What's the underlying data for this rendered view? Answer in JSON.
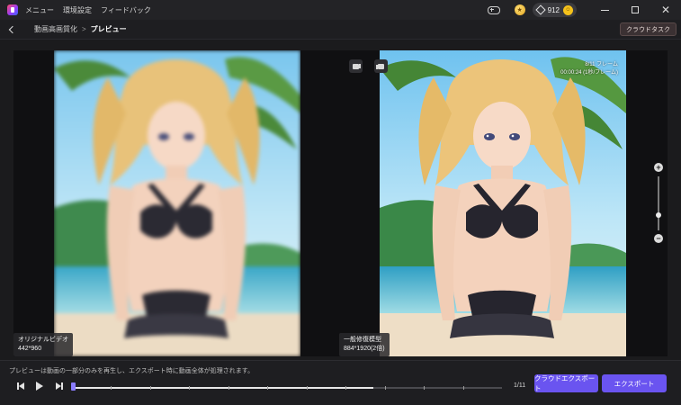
{
  "menu": {
    "items": [
      "メニュー",
      "環境設定",
      "フィードバック"
    ]
  },
  "status": {
    "credits": "912"
  },
  "breadcrumb": {
    "parent": "動画高画質化",
    "separator": ">",
    "current": "プレビュー"
  },
  "header": {
    "cloud_task_label": "クラウドタスク"
  },
  "preview": {
    "original": {
      "label": "オリジナルビデオ",
      "resolution": "442*960"
    },
    "enhanced": {
      "label": "一般修復模型",
      "resolution": "884*1920(2倍)"
    },
    "frame_info_line1": "8/11 フレーム",
    "frame_info_line2": "00:00:24 (1秒/フレーム)"
  },
  "playback": {
    "note": "プレビューは動画の一部分のみを再生し、エクスポート時に動画全体が処理されます。",
    "frame_count": "1/11",
    "progress": 0.7,
    "total_frames": 11
  },
  "actions": {
    "cloud_export_label": "クラウドエクスポート",
    "export_label": "エクスポート"
  },
  "colors": {
    "accent": "#6a54f0",
    "background": "#1b1b1d"
  }
}
